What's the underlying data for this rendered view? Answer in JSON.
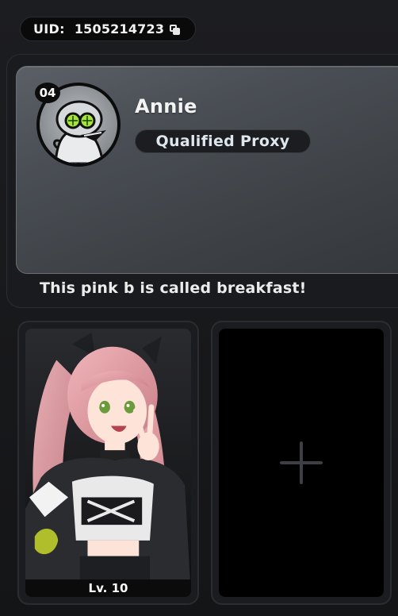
{
  "uid": {
    "label": "UID:",
    "value": "1505214723",
    "copy_icon": "copy-icon"
  },
  "profile": {
    "level": "04",
    "avatar_icon": "frog-goggles-avatar",
    "name": "Annie",
    "title": "Qualified Proxy",
    "bio": "This pink b is called breakfast!"
  },
  "showcase": {
    "slots": [
      {
        "type": "agent",
        "level_label": "Lv. 10",
        "hair_color": "#e6a3a8"
      },
      {
        "type": "empty",
        "icon": "add-icon"
      }
    ]
  }
}
